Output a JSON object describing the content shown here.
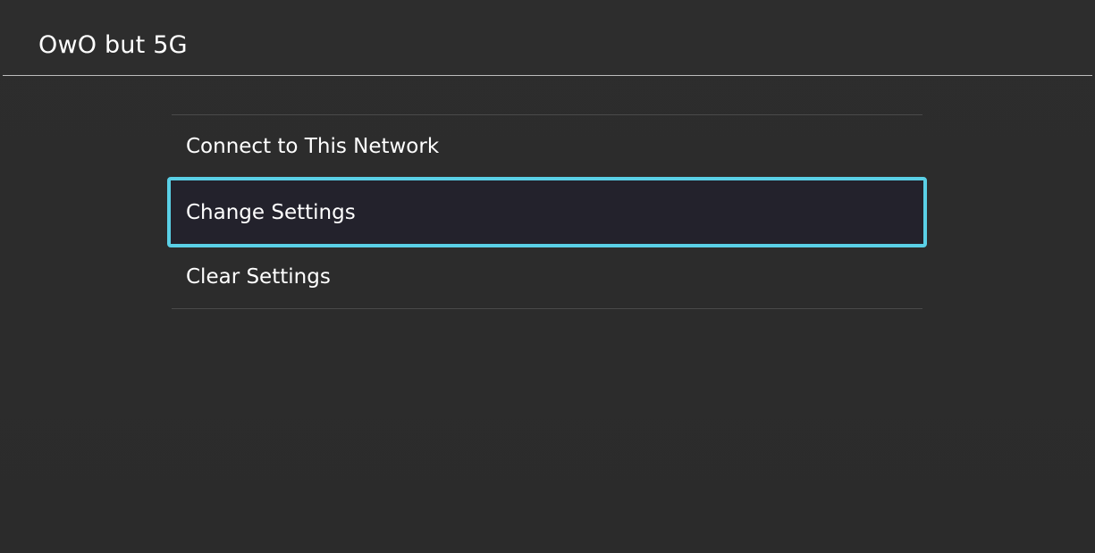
{
  "header": {
    "title": "OwO but 5G"
  },
  "menu": {
    "items": [
      {
        "label": "Connect to This Network",
        "selected": false
      },
      {
        "label": "Change Settings",
        "selected": true
      },
      {
        "label": "Clear Settings",
        "selected": false
      }
    ]
  },
  "colors": {
    "background": "#2d2d2d",
    "selection_outline": "#5ad0e6",
    "selection_fill": "#23222c",
    "text": "#ffffff"
  }
}
